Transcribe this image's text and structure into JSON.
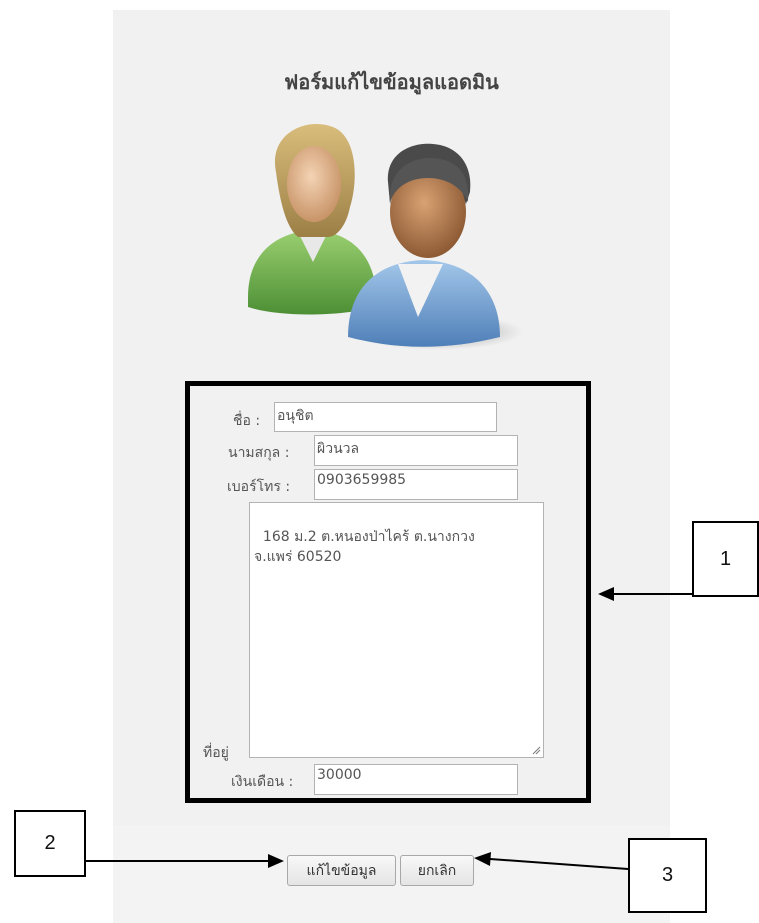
{
  "form": {
    "title": "ฟอร์มแก้ไขข้อมูลแอดมิน",
    "fields": {
      "first_name": {
        "label": "ชื่อ :",
        "value": "อนุชิต"
      },
      "last_name": {
        "label": "นามสกุล :",
        "value": "ผิวนวล"
      },
      "phone": {
        "label": "เบอร์โทร :",
        "value": "0903659985"
      },
      "address": {
        "label": "ที่อยู่",
        "value": "168 ม.2 ต.หนองป่าไคร้ ต.นางกวง\nจ.แพร่ 60520"
      },
      "salary": {
        "label": "เงินเดือน :",
        "value": "30000"
      }
    },
    "buttons": {
      "edit": "แก้ไขข้อมูล",
      "cancel": "ยกเลิก"
    }
  },
  "callouts": {
    "one": "1",
    "two": "2",
    "three": "3"
  },
  "icons": {
    "avatar": "admin-users-icon"
  },
  "colors": {
    "panel_background": "#f1f1f1",
    "highlight_border": "#000000"
  }
}
